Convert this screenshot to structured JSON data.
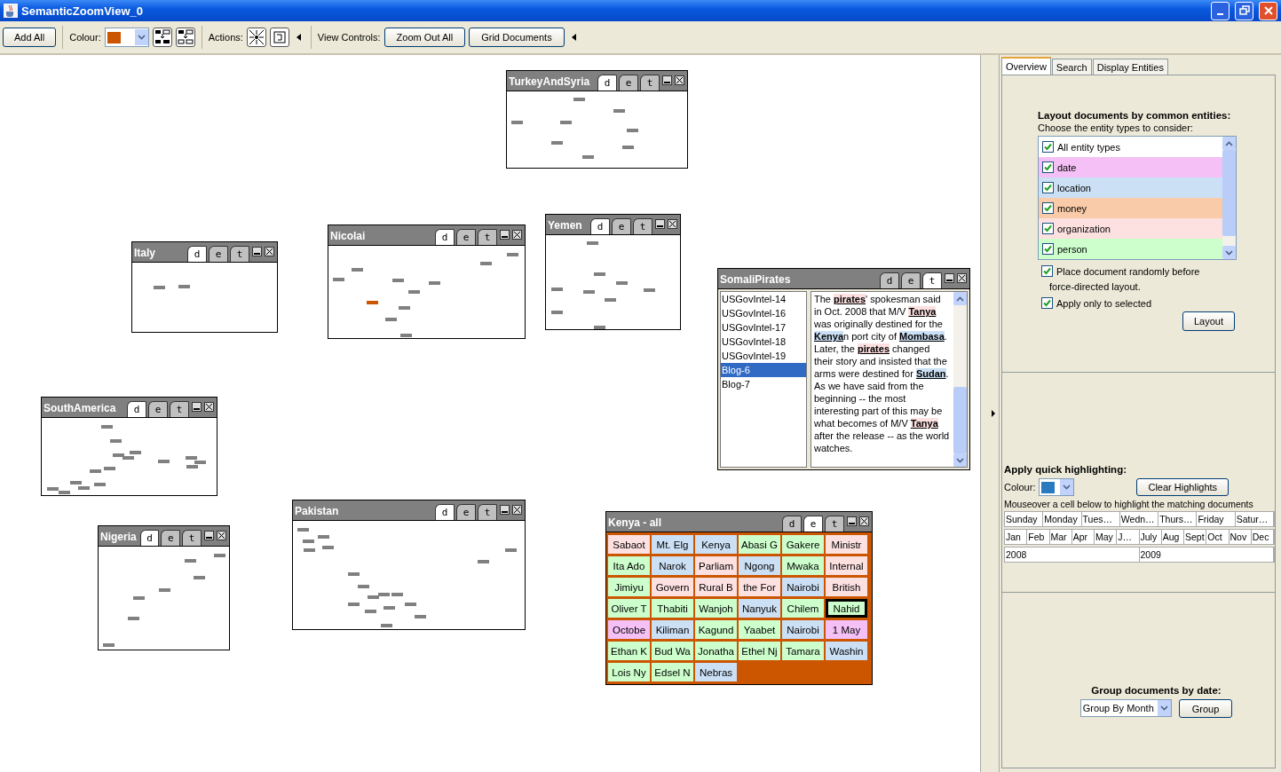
{
  "window": {
    "title": "SemanticZoomView_0"
  },
  "toolbar": {
    "add_all": "Add All",
    "colour_label": "Colour:",
    "color": "#cc5500",
    "actions_label": "Actions:",
    "view_controls_label": "View Controls:",
    "buttons": [
      "Zoom Out All",
      "Grid Documents"
    ]
  },
  "document_groups": [
    {
      "title": "TurkeyAndSyria",
      "kind": "documents",
      "tabs": [
        {
          "label": "d",
          "selected": true
        },
        {
          "label": "e",
          "selected": false
        },
        {
          "label": "t",
          "selected": false
        }
      ],
      "documents": [
        {
          "highlighted": false
        },
        {
          "highlighted": false
        },
        {
          "highlighted": false
        },
        {
          "highlighted": false
        },
        {
          "highlighted": false
        },
        {
          "highlighted": false
        },
        {
          "highlighted": false
        },
        {
          "highlighted": false
        }
      ]
    },
    {
      "title": "Italy",
      "kind": "documents",
      "tabs": [
        {
          "label": "d",
          "selected": true
        },
        {
          "label": "e",
          "selected": false
        },
        {
          "label": "t",
          "selected": false
        }
      ],
      "documents": [
        {
          "highlighted": false
        },
        {
          "highlighted": false
        }
      ]
    },
    {
      "title": "Nicolai",
      "kind": "documents",
      "tabs": [
        {
          "label": "d",
          "selected": true
        },
        {
          "label": "e",
          "selected": false
        },
        {
          "label": "t",
          "selected": false
        }
      ],
      "documents": [
        {
          "highlighted": false
        },
        {
          "highlighted": false
        },
        {
          "highlighted": false
        },
        {
          "highlighted": false
        },
        {
          "highlighted": false
        },
        {
          "highlighted": false
        },
        {
          "highlighted": false
        },
        {
          "highlighted": true
        },
        {
          "highlighted": false
        },
        {
          "highlighted": false
        },
        {
          "highlighted": false
        }
      ]
    },
    {
      "title": "Yemen",
      "kind": "documents",
      "tabs": [
        {
          "label": "d",
          "selected": true
        },
        {
          "label": "e",
          "selected": false
        },
        {
          "label": "t",
          "selected": false
        }
      ],
      "documents": [
        {
          "highlighted": false
        },
        {
          "highlighted": false
        },
        {
          "highlighted": false
        },
        {
          "highlighted": false
        },
        {
          "highlighted": false
        },
        {
          "highlighted": false
        },
        {
          "highlighted": false
        },
        {
          "highlighted": false
        },
        {
          "highlighted": false
        }
      ]
    },
    {
      "title": "SomaliPirates",
      "kind": "text",
      "tabs": [
        {
          "label": "d",
          "selected": false
        },
        {
          "label": "e",
          "selected": false
        },
        {
          "label": "t",
          "selected": true
        }
      ],
      "document_list": [
        {
          "label": "USGovIntel-14",
          "selected": false
        },
        {
          "label": "USGovIntel-16",
          "selected": false
        },
        {
          "label": "USGovIntel-17",
          "selected": false
        },
        {
          "label": "USGovIntel-18",
          "selected": false
        },
        {
          "label": "USGovIntel-19",
          "selected": false
        },
        {
          "label": "Blog-6",
          "selected": true
        },
        {
          "label": "Blog-7",
          "selected": false
        }
      ],
      "text": [
        {
          "text": "The "
        },
        {
          "text": "pirates",
          "color": "#fde0e0"
        },
        {
          "text": "' spokesman said in Oct. 2008 that M/V "
        },
        {
          "text": "Tanya",
          "color": "#fde0e0"
        },
        {
          "text": " was originally destined for the "
        },
        {
          "text": "Kenya",
          "color": "#cce0f5"
        },
        {
          "text": "n port city of "
        },
        {
          "text": "Mombasa",
          "color": "#cce0f5"
        },
        {
          "text": ". Later, the "
        },
        {
          "text": "pirates",
          "color": "#fde0e0"
        },
        {
          "text": " changed their story and insisted that the arms were destined for "
        },
        {
          "text": "Sudan",
          "color": "#cce0f5"
        },
        {
          "text": ". As we have said from the beginning -- the most interesting part of this may be what becomes of M/V "
        },
        {
          "text": "Tanya",
          "color": "#fde0e0"
        },
        {
          "text": " after the release -- as the world watches."
        }
      ]
    },
    {
      "title": "SouthAmerica",
      "kind": "documents",
      "tabs": [
        {
          "label": "d",
          "selected": true
        },
        {
          "label": "e",
          "selected": false
        },
        {
          "label": "t",
          "selected": false
        }
      ],
      "documents": [
        {
          "highlighted": false
        },
        {
          "highlighted": false
        },
        {
          "highlighted": false
        },
        {
          "highlighted": false
        },
        {
          "highlighted": false
        },
        {
          "highlighted": false
        },
        {
          "highlighted": false
        },
        {
          "highlighted": false
        },
        {
          "highlighted": false
        },
        {
          "highlighted": false
        },
        {
          "highlighted": false
        },
        {
          "highlighted": false
        },
        {
          "highlighted": false
        },
        {
          "highlighted": false
        },
        {
          "highlighted": false
        },
        {
          "highlighted": false
        }
      ]
    },
    {
      "title": "Nigeria",
      "kind": "documents",
      "tabs": [
        {
          "label": "d",
          "selected": true
        },
        {
          "label": "e",
          "selected": false
        },
        {
          "label": "t",
          "selected": false
        }
      ],
      "documents": [
        {
          "highlighted": false
        },
        {
          "highlighted": false
        },
        {
          "highlighted": false
        },
        {
          "highlighted": false
        },
        {
          "highlighted": false
        },
        {
          "highlighted": false
        },
        {
          "highlighted": false
        }
      ]
    },
    {
      "title": "Pakistan",
      "kind": "documents",
      "tabs": [
        {
          "label": "d",
          "selected": true
        },
        {
          "label": "e",
          "selected": false
        },
        {
          "label": "t",
          "selected": false
        }
      ],
      "documents": [
        {
          "highlighted": false
        },
        {
          "highlighted": false
        },
        {
          "highlighted": false
        },
        {
          "highlighted": false
        },
        {
          "highlighted": false
        },
        {
          "highlighted": false
        },
        {
          "highlighted": false
        },
        {
          "highlighted": false
        },
        {
          "highlighted": false
        },
        {
          "highlighted": false
        },
        {
          "highlighted": false
        },
        {
          "highlighted": false
        },
        {
          "highlighted": false
        },
        {
          "highlighted": false
        },
        {
          "highlighted": false
        },
        {
          "highlighted": false
        },
        {
          "highlighted": false
        },
        {
          "highlighted": false
        }
      ]
    },
    {
      "title": "Kenya - all",
      "kind": "entities",
      "tabs": [
        {
          "label": "d",
          "selected": false
        },
        {
          "label": "e",
          "selected": true
        },
        {
          "label": "t",
          "selected": false
        }
      ],
      "entities": [
        {
          "text": "Sabaot",
          "color": "#fde0e0",
          "selected": false
        },
        {
          "text": "Mt. Elg",
          "color": "#cce0f5",
          "selected": false
        },
        {
          "text": "Kenya",
          "color": "#cce0f5",
          "selected": false
        },
        {
          "text": "Abasi G",
          "color": "#ccffcc",
          "selected": false
        },
        {
          "text": "Gakere",
          "color": "#ccffcc",
          "selected": false
        },
        {
          "text": "Ministr",
          "color": "#fde0e0",
          "selected": false
        },
        {
          "text": "Ita Ado",
          "color": "#ccffcc",
          "selected": false
        },
        {
          "text": "Narok",
          "color": "#cce0f5",
          "selected": false
        },
        {
          "text": "Parliam",
          "color": "#fde0e0",
          "selected": false
        },
        {
          "text": "Ngong",
          "color": "#cce0f5",
          "selected": false
        },
        {
          "text": "Mwaka",
          "color": "#ccffcc",
          "selected": false
        },
        {
          "text": "Internal",
          "color": "#fde0e0",
          "selected": false
        },
        {
          "text": "Jimiyu",
          "color": "#ccffcc",
          "selected": false
        },
        {
          "text": "Govern",
          "color": "#fde0e0",
          "selected": false
        },
        {
          "text": "Rural B",
          "color": "#fde0e0",
          "selected": false
        },
        {
          "text": "the For",
          "color": "#fde0e0",
          "selected": false
        },
        {
          "text": "Nairobi",
          "color": "#cce0f5",
          "selected": false
        },
        {
          "text": "British",
          "color": "#fde0e0",
          "selected": false
        },
        {
          "text": "Oliver T",
          "color": "#ccffcc",
          "selected": false
        },
        {
          "text": "Thabiti",
          "color": "#ccffcc",
          "selected": false
        },
        {
          "text": "Wanjoh",
          "color": "#ccffcc",
          "selected": false
        },
        {
          "text": "Nanyuk",
          "color": "#cce0f5",
          "selected": false
        },
        {
          "text": "Chilem",
          "color": "#ccffcc",
          "selected": false
        },
        {
          "text": "Nahid",
          "color": "#ccffcc",
          "selected": true
        },
        {
          "text": "Octobe",
          "color": "#f5c0f5",
          "selected": false
        },
        {
          "text": "Kiliman",
          "color": "#cce0f5",
          "selected": false
        },
        {
          "text": "Kagund",
          "color": "#ccffcc",
          "selected": false
        },
        {
          "text": "Yaabet",
          "color": "#ccffcc",
          "selected": false
        },
        {
          "text": "Nairobi",
          "color": "#cce0f5",
          "selected": false
        },
        {
          "text": "1 May",
          "color": "#f5c0f5",
          "selected": false
        },
        {
          "text": "Ethan K",
          "color": "#ccffcc",
          "selected": false
        },
        {
          "text": "Bud Wa",
          "color": "#ccffcc",
          "selected": false
        },
        {
          "text": "Jonatha",
          "color": "#ccffcc",
          "selected": false
        },
        {
          "text": "Ethel Nj",
          "color": "#ccffcc",
          "selected": false
        },
        {
          "text": "Tamara",
          "color": "#ccffcc",
          "selected": false
        },
        {
          "text": "Washin",
          "color": "#cce0f5",
          "selected": false
        },
        {
          "text": "Lois Ny",
          "color": "#ccffcc",
          "selected": false
        },
        {
          "text": "Edsel N",
          "color": "#ccffcc",
          "selected": false
        },
        {
          "text": "Nebras",
          "color": "#cce0f5",
          "selected": false
        }
      ]
    }
  ],
  "side_panel": {
    "tabs": [
      {
        "label": "Overview",
        "selected": true
      },
      {
        "label": "Search",
        "selected": false
      },
      {
        "label": "Display Entities",
        "selected": false
      }
    ],
    "layout": {
      "heading": "Layout documents by common entities:",
      "hint": "Choose the entity types to consider:",
      "entity_types": [
        {
          "label": "All entity types",
          "checked": true,
          "color": "#ffffff"
        },
        {
          "label": "date",
          "checked": true,
          "color": "#f5c0f5"
        },
        {
          "label": "location",
          "checked": true,
          "color": "#cce0f5"
        },
        {
          "label": "money",
          "checked": true,
          "color": "#f9cba8"
        },
        {
          "label": "organization",
          "checked": true,
          "color": "#fde0e0"
        },
        {
          "label": "person",
          "checked": true,
          "color": "#ccffcc"
        }
      ],
      "options": [
        {
          "label": "Place document randomly before",
          "continuation": "force-directed layout.",
          "checked": true
        },
        {
          "label": "Apply only to selected",
          "checked": true
        }
      ],
      "button": "Layout"
    },
    "highlighting": {
      "heading": "Apply quick highlighting:",
      "colour_label": "Colour:",
      "color": "#2a7ac0",
      "clear_button": "Clear Highlights",
      "hint": "Mouseover a cell below to highlight the matching documents",
      "days": [
        "Sunday",
        "Monday",
        "Tues…",
        "Wedn…",
        "Thurs…",
        "Friday",
        "Satur…"
      ],
      "months": [
        "Jan",
        "Feb",
        "Mar",
        "Apr",
        "May",
        "J…",
        "July",
        "Aug",
        "Sept",
        "Oct",
        "Nov",
        "Dec"
      ],
      "years": [
        "2008",
        "2009"
      ]
    },
    "grouping": {
      "heading": "Group documents by date:",
      "select": "Group By Month",
      "button": "Group"
    }
  }
}
